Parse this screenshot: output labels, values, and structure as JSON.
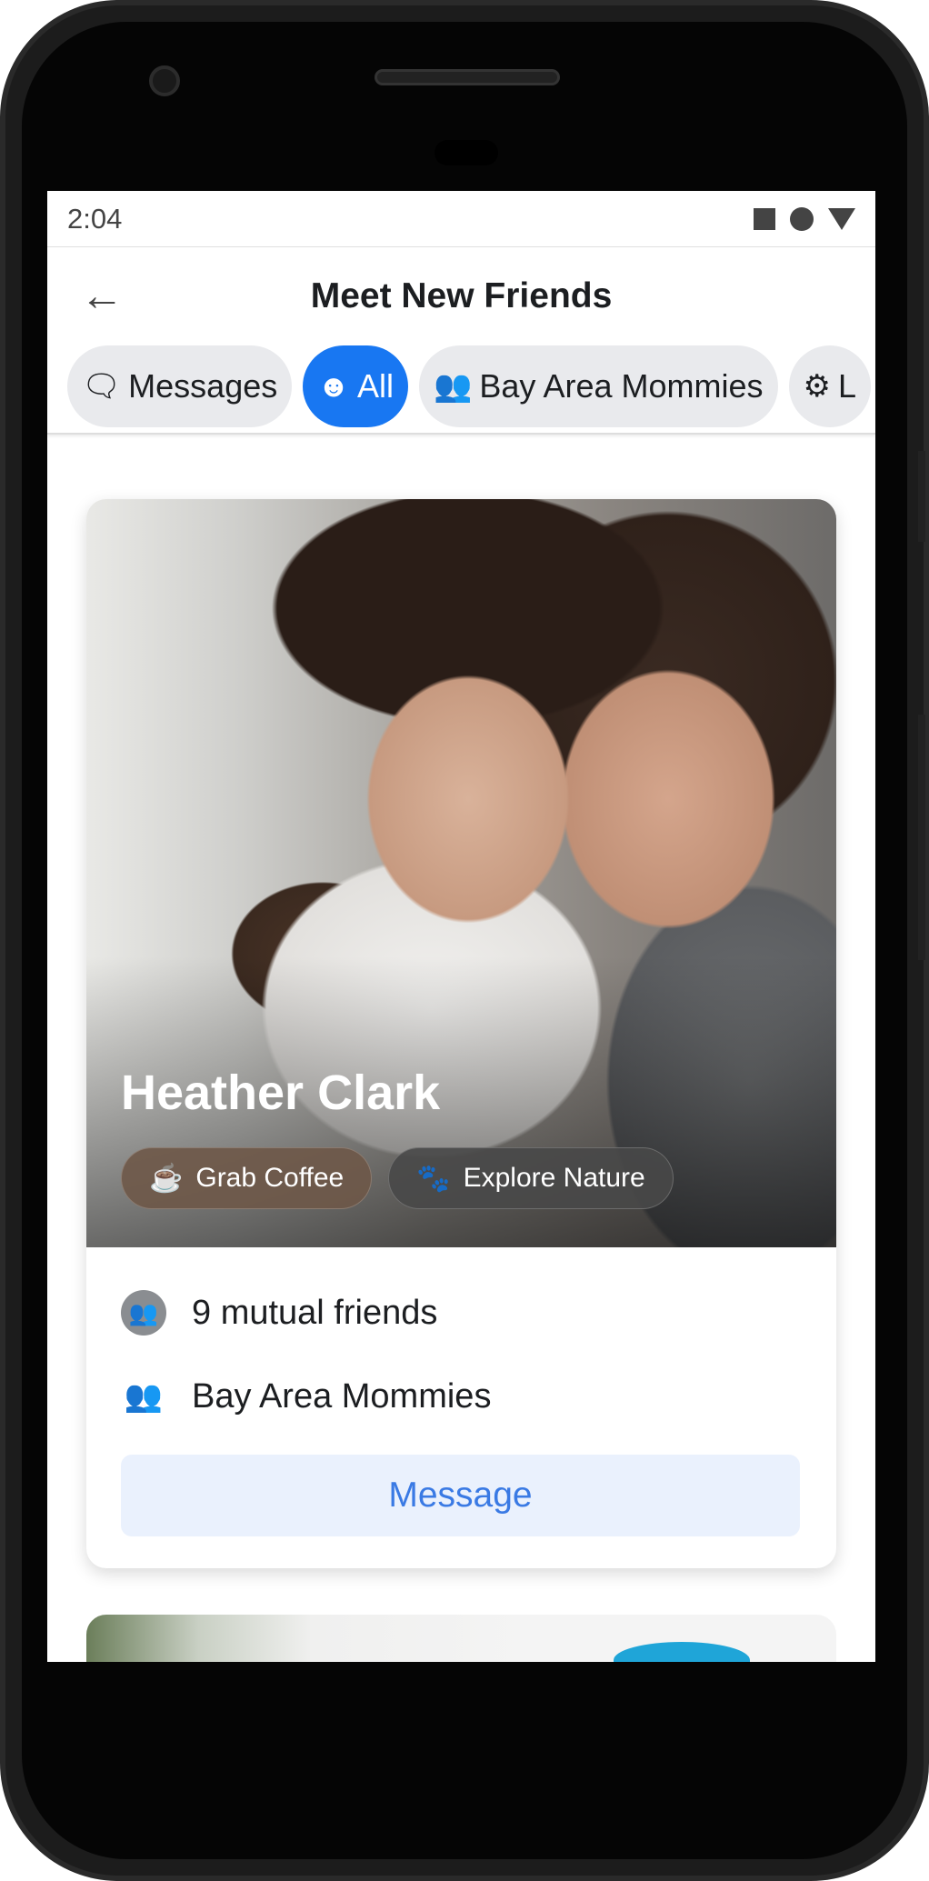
{
  "status_bar": {
    "time": "2:04"
  },
  "header": {
    "title": "Meet New Friends",
    "back_icon": "arrow-left-icon"
  },
  "filters": [
    {
      "label": "Messages",
      "icon": "chat-bubbles-icon",
      "active": false
    },
    {
      "label": "All",
      "icon": "user-circle-icon",
      "active": true
    },
    {
      "label": "Bay Area Mommies",
      "icon": "users-icon",
      "active": false
    },
    {
      "label": "L",
      "icon": "gear-icon",
      "active": false
    }
  ],
  "card": {
    "name": "Heather Clark",
    "interests": [
      {
        "label": "Grab Coffee",
        "icon": "coffee-cup-icon"
      },
      {
        "label": "Explore Nature",
        "icon": "paw-icon"
      }
    ],
    "mutual_friends": "9 mutual friends",
    "group": "Bay Area Mommies",
    "message_label": "Message"
  },
  "colors": {
    "accent": "#1877f2",
    "button_bg": "#eaf1fd",
    "button_text": "#3a7ae4"
  }
}
